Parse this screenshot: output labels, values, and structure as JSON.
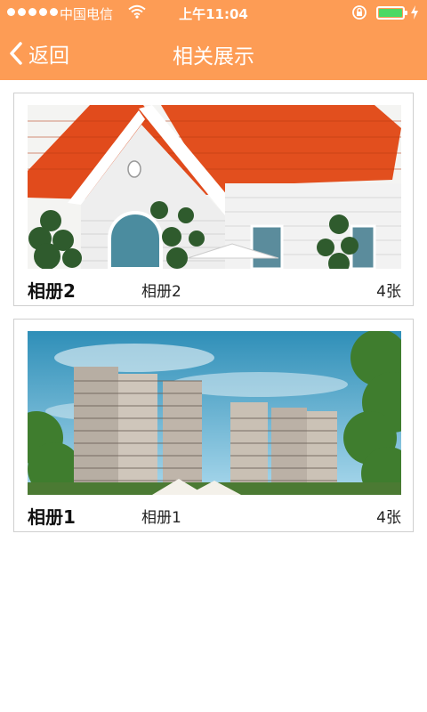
{
  "status_bar": {
    "carrier": "中国电信",
    "time": "上午11:04",
    "signal_icon": "signal-dots-icon",
    "wifi_icon": "wifi-icon",
    "lock_icon": "rotation-lock-icon",
    "battery_icon": "battery-icon",
    "charging_icon": "charging-bolt-icon",
    "battery_color": "#4cd964"
  },
  "nav": {
    "back_label": "返回",
    "back_icon": "chevron-left-icon",
    "title": "相关展示",
    "background": "#fd9c55"
  },
  "albums": [
    {
      "name": "相册2",
      "description": "相册2",
      "count": "4张",
      "thumbnail": "red-roof-white-house"
    },
    {
      "name": "相册1",
      "description": "相册1",
      "count": "4张",
      "thumbnail": "high-rise-apartment-buildings"
    }
  ]
}
